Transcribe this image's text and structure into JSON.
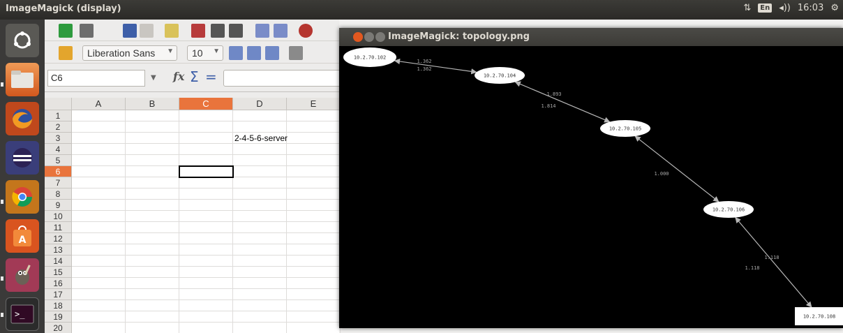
{
  "panel": {
    "title": "ImageMagick (display)",
    "keyboard": "En",
    "volume_icon": "◂))",
    "time": "16:03",
    "settings_icon": "⚙"
  },
  "launcher": {
    "items": [
      "dash-icon",
      "files-icon",
      "firefox-icon",
      "eclipse-icon",
      "chrome-icon",
      "software-center-icon",
      "gimp-icon",
      "terminal-icon"
    ]
  },
  "calc": {
    "font_name": "Liberation Sans",
    "font_size": "10",
    "name_box": "C6",
    "columns": [
      "A",
      "B",
      "C",
      "D",
      "E"
    ],
    "active_column": "C",
    "rows": [
      "1",
      "2",
      "3",
      "4",
      "5",
      "6",
      "7",
      "8",
      "9",
      "10",
      "11",
      "12",
      "13",
      "14",
      "15",
      "16",
      "17",
      "18",
      "19",
      "20"
    ],
    "active_row": "6",
    "cells": {
      "D3": "2-4-5-6-server"
    }
  },
  "viewer": {
    "title": "ImageMagick: topology.png",
    "nodes": [
      "10.2.70.102",
      "10.2.70.104",
      "10.2.70.105",
      "10.2.70.106",
      "10.2.70.108"
    ],
    "edge_labels": [
      [
        "1.362",
        "1.362"
      ],
      [
        "1.893",
        "1.814"
      ],
      [
        "1.000"
      ],
      [
        "1.118",
        "1.118"
      ]
    ]
  },
  "colors": {
    "accent": "#e9743c",
    "panel": "#3c3b37",
    "launcher": "#3b3a39"
  }
}
